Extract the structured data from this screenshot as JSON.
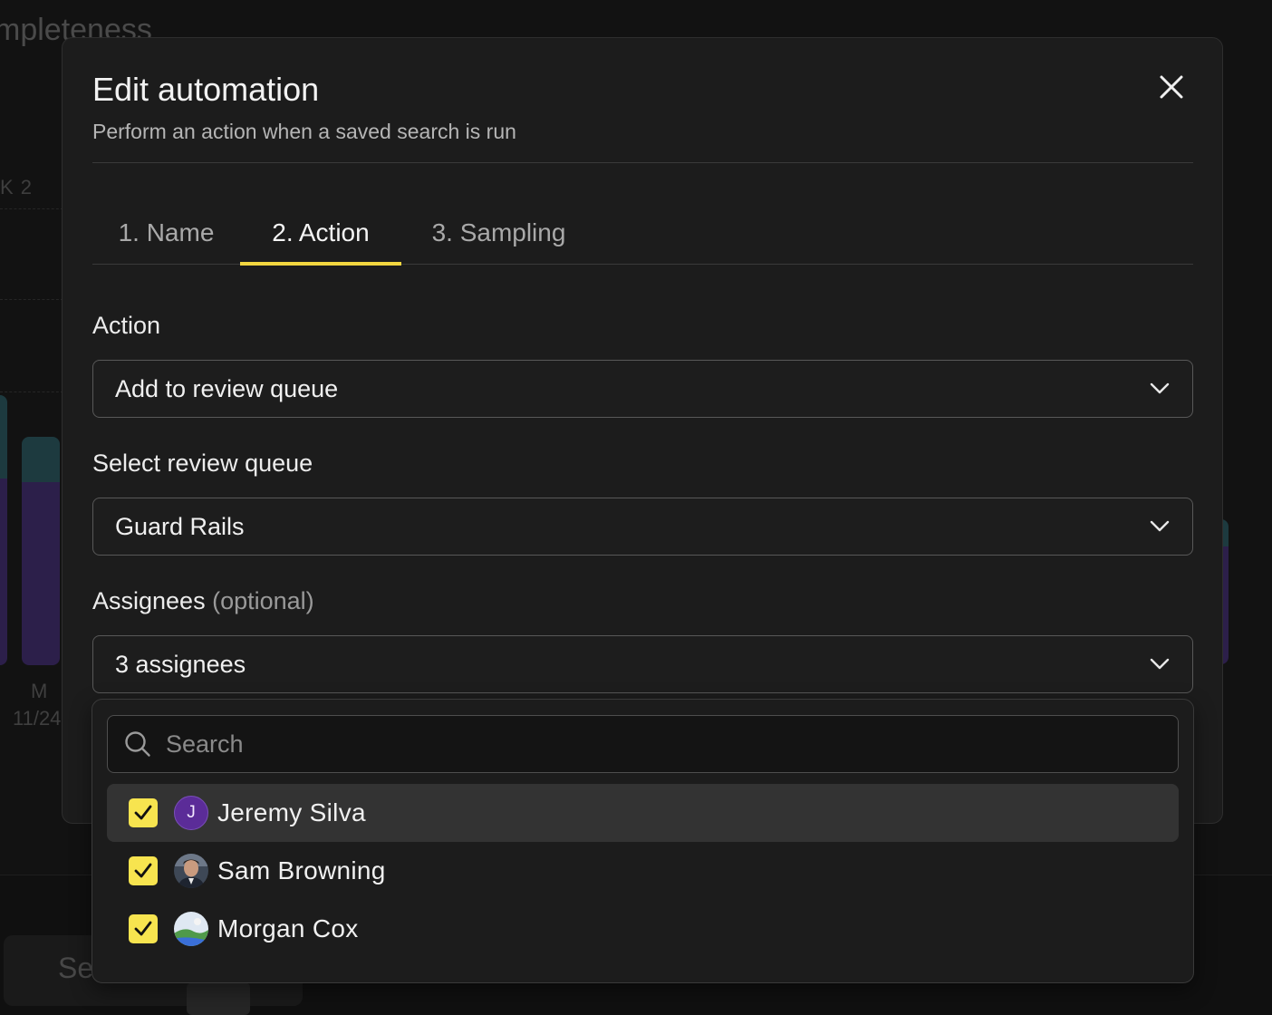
{
  "background": {
    "title_fragment": "mpleteness",
    "week_label": "K 2",
    "axis_day": "M",
    "axis_date": "11/24",
    "button_fragment": "Se",
    "series_colors": {
      "teal": "#1d3a3f",
      "purple": "#2c1f4a"
    }
  },
  "modal": {
    "title": "Edit automation",
    "subtitle": "Perform an action when a saved search is run",
    "tabs": [
      {
        "label": "1. Name",
        "active": false
      },
      {
        "label": "2. Action",
        "active": true
      },
      {
        "label": "3. Sampling",
        "active": false
      }
    ],
    "action": {
      "label": "Action",
      "value": "Add to review queue"
    },
    "review_queue": {
      "label": "Select review queue",
      "value": "Guard Rails"
    },
    "assignees": {
      "label": "Assignees",
      "optional_label": "(optional)",
      "value": "3 assignees"
    }
  },
  "assignee_dropdown": {
    "search_placeholder": "Search",
    "options": [
      {
        "name": "Jeremy Silva",
        "checked": true,
        "avatar": "letter",
        "initial": "J",
        "highlighted": true
      },
      {
        "name": "Sam Browning",
        "checked": true,
        "avatar": "photo-portrait",
        "highlighted": false
      },
      {
        "name": "Morgan Cox",
        "checked": true,
        "avatar": "photo-landscape",
        "highlighted": false
      }
    ]
  },
  "colors": {
    "accent_tab_underline": "#f2d640",
    "checkbox_fill": "#f7e44f",
    "avatar_letter_bg": "#5b2c98"
  },
  "icons": [
    "close-icon",
    "chevron-down-icon",
    "search-icon",
    "check-icon"
  ]
}
